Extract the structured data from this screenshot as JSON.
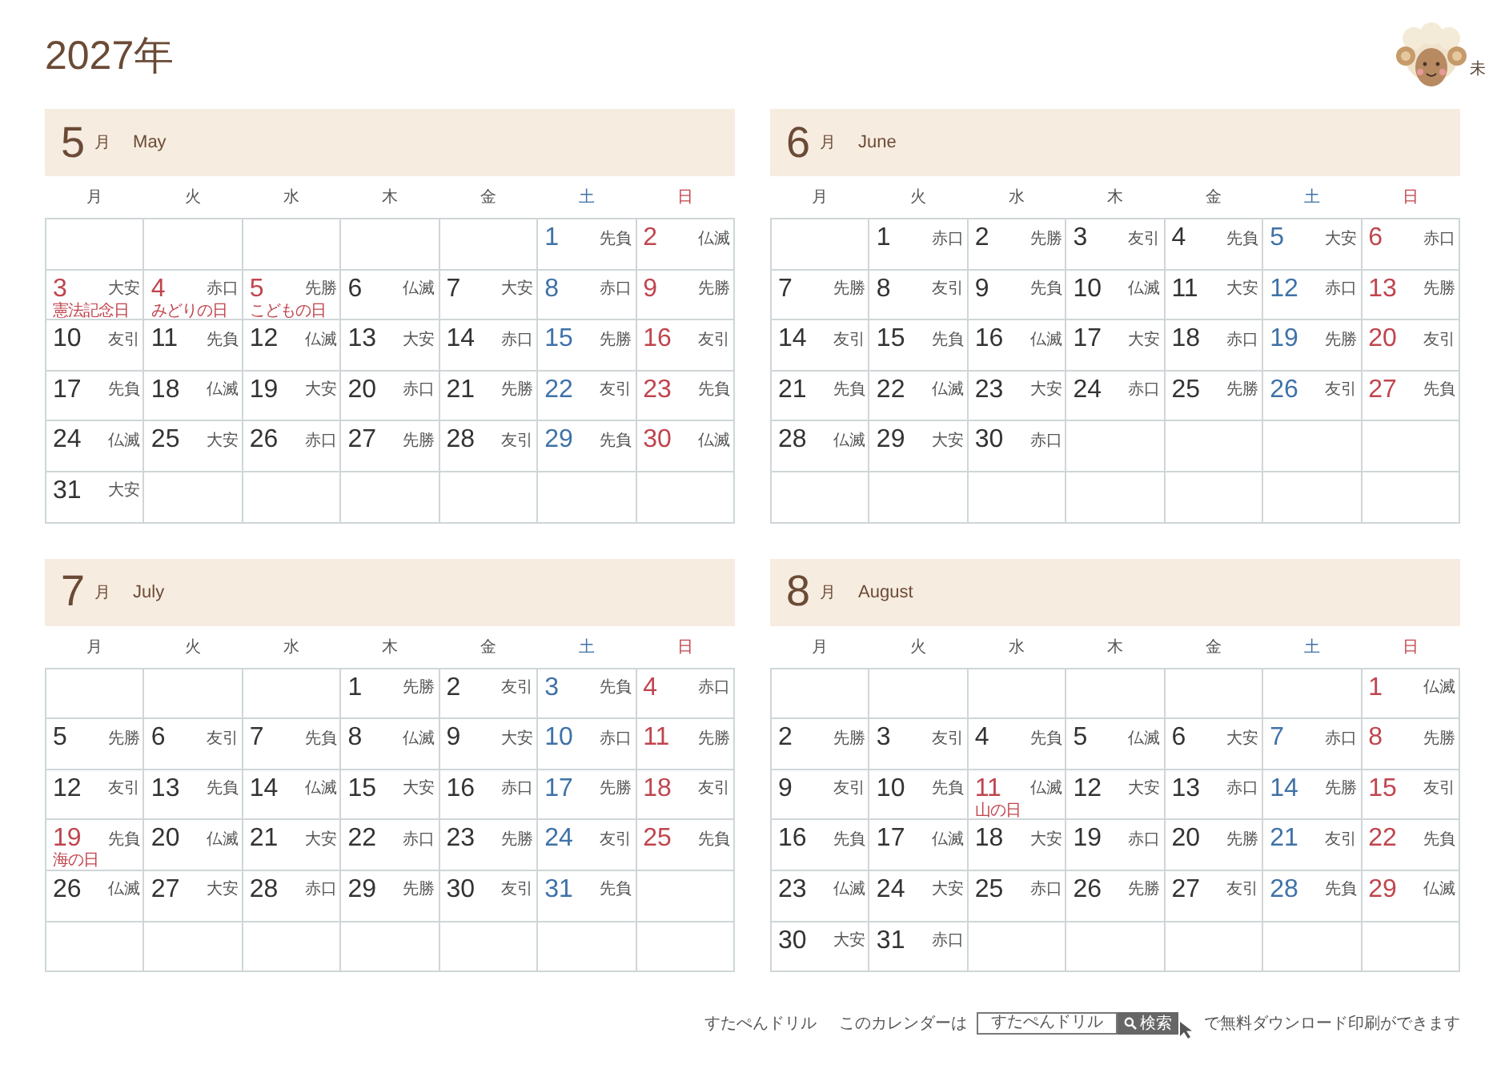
{
  "title": "2027年",
  "zodiac": {
    "label": "未"
  },
  "months": [
    {
      "number": "5",
      "unit": "月",
      "name": "May",
      "weekdays": [
        {
          "label": "月",
          "kind": "weekday"
        },
        {
          "label": "火",
          "kind": "weekday"
        },
        {
          "label": "水",
          "kind": "weekday"
        },
        {
          "label": "木",
          "kind": "weekday"
        },
        {
          "label": "金",
          "kind": "weekday"
        },
        {
          "label": "土",
          "kind": "saturday"
        },
        {
          "label": "日",
          "kind": "sunday"
        }
      ],
      "weeks": [
        [
          {
            "kind": "empty"
          },
          {
            "kind": "empty"
          },
          {
            "kind": "empty"
          },
          {
            "kind": "empty"
          },
          {
            "kind": "empty"
          },
          {
            "day": "1",
            "rokuyo": "先負",
            "kind": "saturday"
          },
          {
            "day": "2",
            "rokuyo": "仏滅",
            "kind": "sunday"
          }
        ],
        [
          {
            "day": "3",
            "rokuyo": "大安",
            "kind": "holiday",
            "holiday": "憲法記念日"
          },
          {
            "day": "4",
            "rokuyo": "赤口",
            "kind": "holiday",
            "holiday": "みどりの日"
          },
          {
            "day": "5",
            "rokuyo": "先勝",
            "kind": "holiday",
            "holiday": "こどもの日"
          },
          {
            "day": "6",
            "rokuyo": "仏滅",
            "kind": "weekday"
          },
          {
            "day": "7",
            "rokuyo": "大安",
            "kind": "weekday"
          },
          {
            "day": "8",
            "rokuyo": "赤口",
            "kind": "saturday"
          },
          {
            "day": "9",
            "rokuyo": "先勝",
            "kind": "sunday"
          }
        ],
        [
          {
            "day": "10",
            "rokuyo": "友引",
            "kind": "weekday"
          },
          {
            "day": "11",
            "rokuyo": "先負",
            "kind": "weekday"
          },
          {
            "day": "12",
            "rokuyo": "仏滅",
            "kind": "weekday"
          },
          {
            "day": "13",
            "rokuyo": "大安",
            "kind": "weekday"
          },
          {
            "day": "14",
            "rokuyo": "赤口",
            "kind": "weekday"
          },
          {
            "day": "15",
            "rokuyo": "先勝",
            "kind": "saturday"
          },
          {
            "day": "16",
            "rokuyo": "友引",
            "kind": "sunday"
          }
        ],
        [
          {
            "day": "17",
            "rokuyo": "先負",
            "kind": "weekday"
          },
          {
            "day": "18",
            "rokuyo": "仏滅",
            "kind": "weekday"
          },
          {
            "day": "19",
            "rokuyo": "大安",
            "kind": "weekday"
          },
          {
            "day": "20",
            "rokuyo": "赤口",
            "kind": "weekday"
          },
          {
            "day": "21",
            "rokuyo": "先勝",
            "kind": "weekday"
          },
          {
            "day": "22",
            "rokuyo": "友引",
            "kind": "saturday"
          },
          {
            "day": "23",
            "rokuyo": "先負",
            "kind": "sunday"
          }
        ],
        [
          {
            "day": "24",
            "rokuyo": "仏滅",
            "kind": "weekday"
          },
          {
            "day": "25",
            "rokuyo": "大安",
            "kind": "weekday"
          },
          {
            "day": "26",
            "rokuyo": "赤口",
            "kind": "weekday"
          },
          {
            "day": "27",
            "rokuyo": "先勝",
            "kind": "weekday"
          },
          {
            "day": "28",
            "rokuyo": "友引",
            "kind": "weekday"
          },
          {
            "day": "29",
            "rokuyo": "先負",
            "kind": "saturday"
          },
          {
            "day": "30",
            "rokuyo": "仏滅",
            "kind": "sunday"
          }
        ],
        [
          {
            "day": "31",
            "rokuyo": "大安",
            "kind": "weekday"
          },
          {
            "kind": "empty"
          },
          {
            "kind": "empty"
          },
          {
            "kind": "empty"
          },
          {
            "kind": "empty"
          },
          {
            "kind": "empty"
          },
          {
            "kind": "empty"
          }
        ]
      ]
    },
    {
      "number": "6",
      "unit": "月",
      "name": "June",
      "weekdays": [
        {
          "label": "月",
          "kind": "weekday"
        },
        {
          "label": "火",
          "kind": "weekday"
        },
        {
          "label": "水",
          "kind": "weekday"
        },
        {
          "label": "木",
          "kind": "weekday"
        },
        {
          "label": "金",
          "kind": "weekday"
        },
        {
          "label": "土",
          "kind": "saturday"
        },
        {
          "label": "日",
          "kind": "sunday"
        }
      ],
      "weeks": [
        [
          {
            "kind": "empty"
          },
          {
            "day": "1",
            "rokuyo": "赤口",
            "kind": "weekday"
          },
          {
            "day": "2",
            "rokuyo": "先勝",
            "kind": "weekday"
          },
          {
            "day": "3",
            "rokuyo": "友引",
            "kind": "weekday"
          },
          {
            "day": "4",
            "rokuyo": "先負",
            "kind": "weekday"
          },
          {
            "day": "5",
            "rokuyo": "大安",
            "kind": "saturday"
          },
          {
            "day": "6",
            "rokuyo": "赤口",
            "kind": "sunday"
          }
        ],
        [
          {
            "day": "7",
            "rokuyo": "先勝",
            "kind": "weekday"
          },
          {
            "day": "8",
            "rokuyo": "友引",
            "kind": "weekday"
          },
          {
            "day": "9",
            "rokuyo": "先負",
            "kind": "weekday"
          },
          {
            "day": "10",
            "rokuyo": "仏滅",
            "kind": "weekday"
          },
          {
            "day": "11",
            "rokuyo": "大安",
            "kind": "weekday"
          },
          {
            "day": "12",
            "rokuyo": "赤口",
            "kind": "saturday"
          },
          {
            "day": "13",
            "rokuyo": "先勝",
            "kind": "sunday"
          }
        ],
        [
          {
            "day": "14",
            "rokuyo": "友引",
            "kind": "weekday"
          },
          {
            "day": "15",
            "rokuyo": "先負",
            "kind": "weekday"
          },
          {
            "day": "16",
            "rokuyo": "仏滅",
            "kind": "weekday"
          },
          {
            "day": "17",
            "rokuyo": "大安",
            "kind": "weekday"
          },
          {
            "day": "18",
            "rokuyo": "赤口",
            "kind": "weekday"
          },
          {
            "day": "19",
            "rokuyo": "先勝",
            "kind": "saturday"
          },
          {
            "day": "20",
            "rokuyo": "友引",
            "kind": "sunday"
          }
        ],
        [
          {
            "day": "21",
            "rokuyo": "先負",
            "kind": "weekday"
          },
          {
            "day": "22",
            "rokuyo": "仏滅",
            "kind": "weekday"
          },
          {
            "day": "23",
            "rokuyo": "大安",
            "kind": "weekday"
          },
          {
            "day": "24",
            "rokuyo": "赤口",
            "kind": "weekday"
          },
          {
            "day": "25",
            "rokuyo": "先勝",
            "kind": "weekday"
          },
          {
            "day": "26",
            "rokuyo": "友引",
            "kind": "saturday"
          },
          {
            "day": "27",
            "rokuyo": "先負",
            "kind": "sunday"
          }
        ],
        [
          {
            "day": "28",
            "rokuyo": "仏滅",
            "kind": "weekday"
          },
          {
            "day": "29",
            "rokuyo": "大安",
            "kind": "weekday"
          },
          {
            "day": "30",
            "rokuyo": "赤口",
            "kind": "weekday"
          },
          {
            "kind": "empty"
          },
          {
            "kind": "empty"
          },
          {
            "kind": "empty"
          },
          {
            "kind": "empty"
          }
        ],
        [
          {
            "kind": "empty"
          },
          {
            "kind": "empty"
          },
          {
            "kind": "empty"
          },
          {
            "kind": "empty"
          },
          {
            "kind": "empty"
          },
          {
            "kind": "empty"
          },
          {
            "kind": "empty"
          }
        ]
      ]
    },
    {
      "number": "7",
      "unit": "月",
      "name": "July",
      "weekdays": [
        {
          "label": "月",
          "kind": "weekday"
        },
        {
          "label": "火",
          "kind": "weekday"
        },
        {
          "label": "水",
          "kind": "weekday"
        },
        {
          "label": "木",
          "kind": "weekday"
        },
        {
          "label": "金",
          "kind": "weekday"
        },
        {
          "label": "土",
          "kind": "saturday"
        },
        {
          "label": "日",
          "kind": "sunday"
        }
      ],
      "weeks": [
        [
          {
            "kind": "empty"
          },
          {
            "kind": "empty"
          },
          {
            "kind": "empty"
          },
          {
            "day": "1",
            "rokuyo": "先勝",
            "kind": "weekday"
          },
          {
            "day": "2",
            "rokuyo": "友引",
            "kind": "weekday"
          },
          {
            "day": "3",
            "rokuyo": "先負",
            "kind": "saturday"
          },
          {
            "day": "4",
            "rokuyo": "赤口",
            "kind": "sunday"
          }
        ],
        [
          {
            "day": "5",
            "rokuyo": "先勝",
            "kind": "weekday"
          },
          {
            "day": "6",
            "rokuyo": "友引",
            "kind": "weekday"
          },
          {
            "day": "7",
            "rokuyo": "先負",
            "kind": "weekday"
          },
          {
            "day": "8",
            "rokuyo": "仏滅",
            "kind": "weekday"
          },
          {
            "day": "9",
            "rokuyo": "大安",
            "kind": "weekday"
          },
          {
            "day": "10",
            "rokuyo": "赤口",
            "kind": "saturday"
          },
          {
            "day": "11",
            "rokuyo": "先勝",
            "kind": "sunday"
          }
        ],
        [
          {
            "day": "12",
            "rokuyo": "友引",
            "kind": "weekday"
          },
          {
            "day": "13",
            "rokuyo": "先負",
            "kind": "weekday"
          },
          {
            "day": "14",
            "rokuyo": "仏滅",
            "kind": "weekday"
          },
          {
            "day": "15",
            "rokuyo": "大安",
            "kind": "weekday"
          },
          {
            "day": "16",
            "rokuyo": "赤口",
            "kind": "weekday"
          },
          {
            "day": "17",
            "rokuyo": "先勝",
            "kind": "saturday"
          },
          {
            "day": "18",
            "rokuyo": "友引",
            "kind": "sunday"
          }
        ],
        [
          {
            "day": "19",
            "rokuyo": "先負",
            "kind": "holiday",
            "holiday": "海の日"
          },
          {
            "day": "20",
            "rokuyo": "仏滅",
            "kind": "weekday"
          },
          {
            "day": "21",
            "rokuyo": "大安",
            "kind": "weekday"
          },
          {
            "day": "22",
            "rokuyo": "赤口",
            "kind": "weekday"
          },
          {
            "day": "23",
            "rokuyo": "先勝",
            "kind": "weekday"
          },
          {
            "day": "24",
            "rokuyo": "友引",
            "kind": "saturday"
          },
          {
            "day": "25",
            "rokuyo": "先負",
            "kind": "sunday"
          }
        ],
        [
          {
            "day": "26",
            "rokuyo": "仏滅",
            "kind": "weekday"
          },
          {
            "day": "27",
            "rokuyo": "大安",
            "kind": "weekday"
          },
          {
            "day": "28",
            "rokuyo": "赤口",
            "kind": "weekday"
          },
          {
            "day": "29",
            "rokuyo": "先勝",
            "kind": "weekday"
          },
          {
            "day": "30",
            "rokuyo": "友引",
            "kind": "weekday"
          },
          {
            "day": "31",
            "rokuyo": "先負",
            "kind": "saturday"
          },
          {
            "kind": "empty"
          }
        ],
        [
          {
            "kind": "empty"
          },
          {
            "kind": "empty"
          },
          {
            "kind": "empty"
          },
          {
            "kind": "empty"
          },
          {
            "kind": "empty"
          },
          {
            "kind": "empty"
          },
          {
            "kind": "empty"
          }
        ]
      ]
    },
    {
      "number": "8",
      "unit": "月",
      "name": "August",
      "weekdays": [
        {
          "label": "月",
          "kind": "weekday"
        },
        {
          "label": "火",
          "kind": "weekday"
        },
        {
          "label": "水",
          "kind": "weekday"
        },
        {
          "label": "木",
          "kind": "weekday"
        },
        {
          "label": "金",
          "kind": "weekday"
        },
        {
          "label": "土",
          "kind": "saturday"
        },
        {
          "label": "日",
          "kind": "sunday"
        }
      ],
      "weeks": [
        [
          {
            "kind": "empty"
          },
          {
            "kind": "empty"
          },
          {
            "kind": "empty"
          },
          {
            "kind": "empty"
          },
          {
            "kind": "empty"
          },
          {
            "kind": "empty"
          },
          {
            "day": "1",
            "rokuyo": "仏滅",
            "kind": "sunday"
          }
        ],
        [
          {
            "day": "2",
            "rokuyo": "先勝",
            "kind": "weekday"
          },
          {
            "day": "3",
            "rokuyo": "友引",
            "kind": "weekday"
          },
          {
            "day": "4",
            "rokuyo": "先負",
            "kind": "weekday"
          },
          {
            "day": "5",
            "rokuyo": "仏滅",
            "kind": "weekday"
          },
          {
            "day": "6",
            "rokuyo": "大安",
            "kind": "weekday"
          },
          {
            "day": "7",
            "rokuyo": "赤口",
            "kind": "saturday"
          },
          {
            "day": "8",
            "rokuyo": "先勝",
            "kind": "sunday"
          }
        ],
        [
          {
            "day": "9",
            "rokuyo": "友引",
            "kind": "weekday"
          },
          {
            "day": "10",
            "rokuyo": "先負",
            "kind": "weekday"
          },
          {
            "day": "11",
            "rokuyo": "仏滅",
            "kind": "holiday",
            "holiday": "山の日"
          },
          {
            "day": "12",
            "rokuyo": "大安",
            "kind": "weekday"
          },
          {
            "day": "13",
            "rokuyo": "赤口",
            "kind": "weekday"
          },
          {
            "day": "14",
            "rokuyo": "先勝",
            "kind": "saturday"
          },
          {
            "day": "15",
            "rokuyo": "友引",
            "kind": "sunday"
          }
        ],
        [
          {
            "day": "16",
            "rokuyo": "先負",
            "kind": "weekday"
          },
          {
            "day": "17",
            "rokuyo": "仏滅",
            "kind": "weekday"
          },
          {
            "day": "18",
            "rokuyo": "大安",
            "kind": "weekday"
          },
          {
            "day": "19",
            "rokuyo": "赤口",
            "kind": "weekday"
          },
          {
            "day": "20",
            "rokuyo": "先勝",
            "kind": "weekday"
          },
          {
            "day": "21",
            "rokuyo": "友引",
            "kind": "saturday"
          },
          {
            "day": "22",
            "rokuyo": "先負",
            "kind": "sunday"
          }
        ],
        [
          {
            "day": "23",
            "rokuyo": "仏滅",
            "kind": "weekday"
          },
          {
            "day": "24",
            "rokuyo": "大安",
            "kind": "weekday"
          },
          {
            "day": "25",
            "rokuyo": "赤口",
            "kind": "weekday"
          },
          {
            "day": "26",
            "rokuyo": "先勝",
            "kind": "weekday"
          },
          {
            "day": "27",
            "rokuyo": "友引",
            "kind": "weekday"
          },
          {
            "day": "28",
            "rokuyo": "先負",
            "kind": "saturday"
          },
          {
            "day": "29",
            "rokuyo": "仏滅",
            "kind": "sunday"
          }
        ],
        [
          {
            "day": "30",
            "rokuyo": "大安",
            "kind": "weekday"
          },
          {
            "day": "31",
            "rokuyo": "赤口",
            "kind": "weekday"
          },
          {
            "kind": "empty"
          },
          {
            "kind": "empty"
          },
          {
            "kind": "empty"
          },
          {
            "kind": "empty"
          },
          {
            "kind": "empty"
          }
        ]
      ]
    }
  ],
  "footer": {
    "brand": "すたぺんドリル",
    "lead": "このカレンダーは",
    "search_value": "すたぺんドリル",
    "search_button": "検索",
    "tail": "で無料ダウンロード印刷ができます"
  }
}
